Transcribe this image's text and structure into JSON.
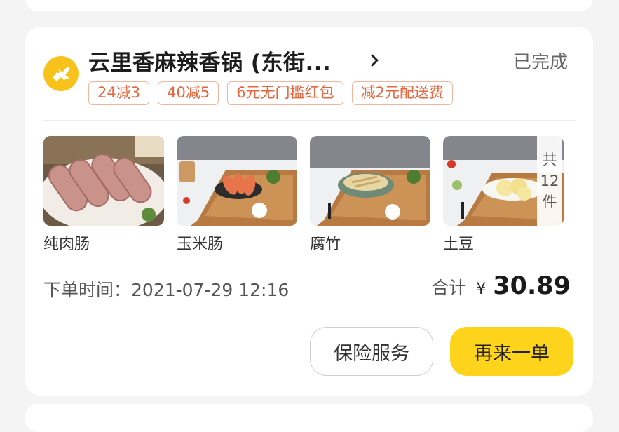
{
  "order": {
    "store_name": "云里香麻辣香锅 (东街...",
    "status": "已完成",
    "promo_tags": [
      "24减3",
      "40减5",
      "6元无门槛红包",
      "减2元配送费"
    ],
    "products": [
      {
        "name": "纯肉肠"
      },
      {
        "name": "玉米肠"
      },
      {
        "name": "腐竹"
      },
      {
        "name": "土豆"
      }
    ],
    "item_count": {
      "line1": "共",
      "line2": "12",
      "line3": "件"
    },
    "order_time": "下单时间：2021-07-29 12:16",
    "total_label": "合计",
    "currency": "¥",
    "total_amount": "30.89",
    "buttons": {
      "insurance": "保险服务",
      "reorder": "再来一单"
    }
  },
  "colors": {
    "brand_yellow": "#fdd31c",
    "tag_orange": "#e8643c",
    "logo_yellow": "#f7c21c"
  },
  "icons": {
    "store_logo": "store-logo-icon",
    "chevron": "chevron-right-icon"
  }
}
